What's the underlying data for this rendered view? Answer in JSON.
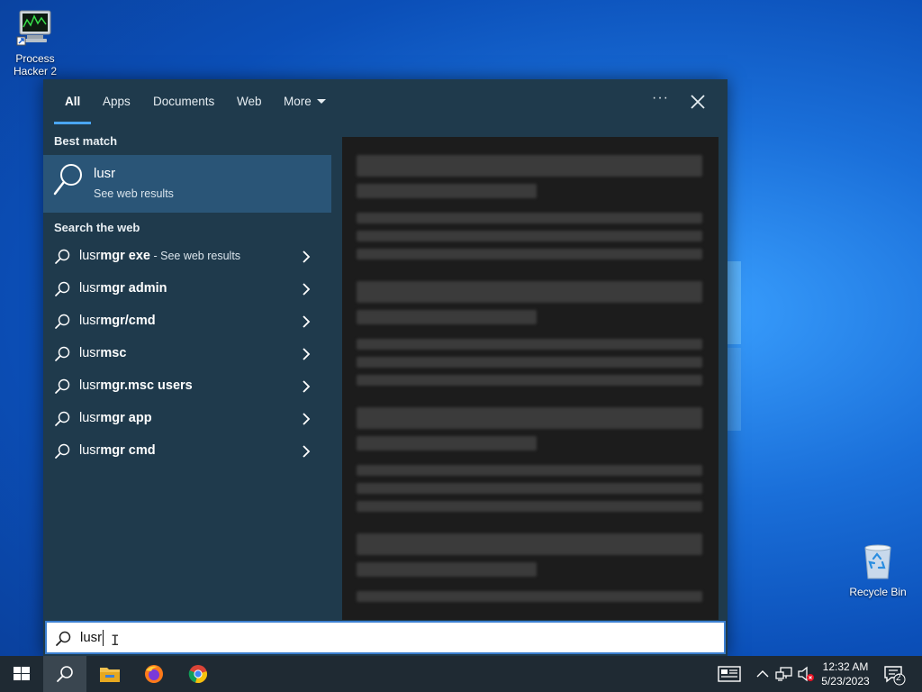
{
  "desktop": {
    "icons": [
      {
        "label": "Process Hacker 2"
      },
      {
        "label": "Recycle Bin"
      }
    ]
  },
  "search_panel": {
    "tabs": [
      {
        "label": "All",
        "active": true
      },
      {
        "label": "Apps"
      },
      {
        "label": "Documents"
      },
      {
        "label": "Web"
      },
      {
        "label": "More"
      }
    ],
    "more_options": "···",
    "best_match": {
      "heading": "Best match",
      "title": "lusr",
      "subtitle": "See web results"
    },
    "search_the_web": {
      "heading": "Search the web",
      "items": [
        {
          "typed": "lusr",
          "rest": "mgr exe",
          "suffix": " - See web results"
        },
        {
          "typed": "lusr",
          "rest": "mgr admin"
        },
        {
          "typed": "lusr",
          "rest": "mgr/cmd"
        },
        {
          "typed": "lusr",
          "rest": "msc"
        },
        {
          "typed": "lusr",
          "rest": "mgr.msc users"
        },
        {
          "typed": "lusr",
          "rest": "mgr app"
        },
        {
          "typed": "lusr",
          "rest": "mgr cmd"
        }
      ]
    }
  },
  "search_box": {
    "value": "lusr"
  },
  "taskbar": {
    "clock_time": "12:32 AM",
    "clock_date": "5/23/2023",
    "notification_count": "2"
  },
  "colors": {
    "panel_bg": "#1f3a4c",
    "best_match_bg": "#2a5577",
    "accent": "#4aa6f2",
    "taskbar_bg": "#1f2a33"
  }
}
